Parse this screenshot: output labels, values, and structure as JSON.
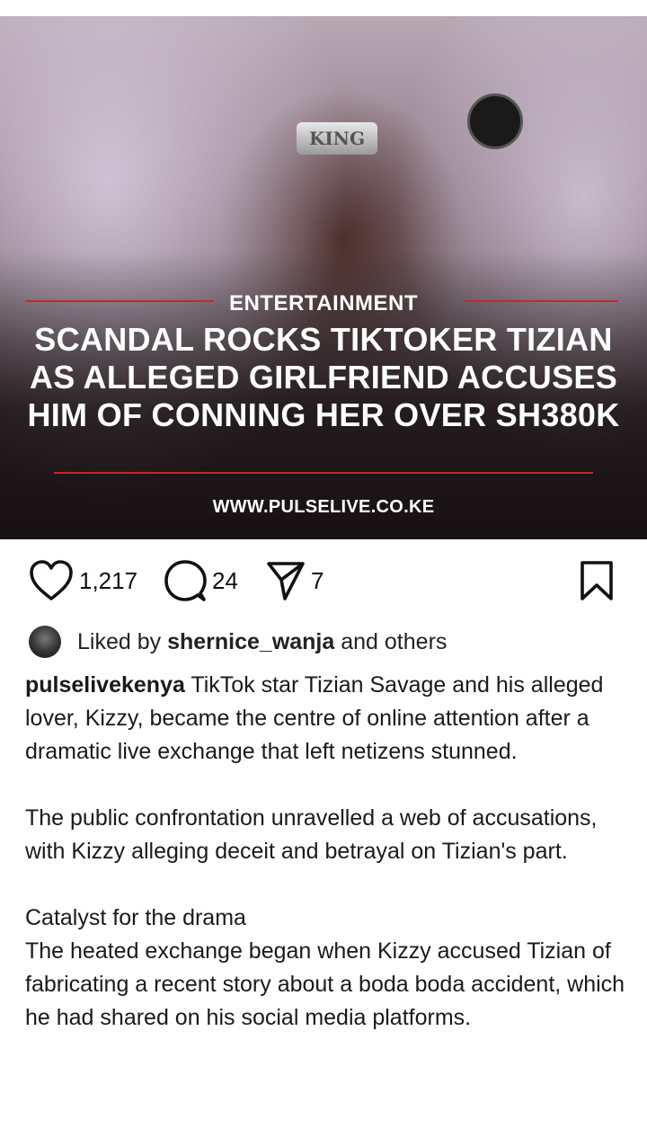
{
  "post": {
    "image": {
      "category": "ENTERTAINMENT",
      "headline": "SCANDAL ROCKS TIKTOKER TIZIAN AS ALLEGED GIRLFRIEND ACCUSES HIM OF CONNING HER OVER SH380K",
      "website": "WWW.PULSELIVE.CO.KE",
      "necklace_text": "KING"
    },
    "actions": {
      "likes": "1,217",
      "comments": "24",
      "shares": "7"
    },
    "liked_by": {
      "prefix": "Liked by",
      "user": "shernice_wanja",
      "suffix": "and others"
    },
    "caption": {
      "username": "pulselivekenya",
      "p1": "TikTok star Tizian Savage and his alleged lover, Kizzy, became the centre of online attention after a dramatic live exchange that left netizens stunned.",
      "p2": "The public confrontation unravelled a web of accusations, with Kizzy alleging deceit and betrayal on Tizian's part.",
      "p3_heading": "Catalyst for the drama",
      "p3_body": "The heated exchange began when Kizzy accused Tizian of fabricating a recent story about a boda boda accident, which he had shared on his social media platforms."
    }
  },
  "colors": {
    "accent_red": "#c62828",
    "text": "#111111"
  }
}
